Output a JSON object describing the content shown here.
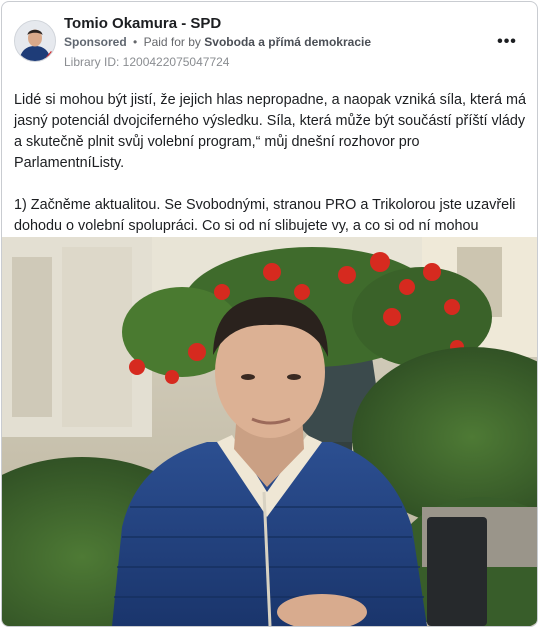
{
  "ad": {
    "page_name": "Tomio Okamura - SPD",
    "sponsored_label": "Sponsored",
    "separator": "•",
    "paid_for_prefix": "Paid for by",
    "funder": "Svoboda a přímá demokracie",
    "library_id": "Library ID: 1200422075047724",
    "more_icon": "more-horizontal-icon",
    "more_glyph": "•••"
  },
  "post": {
    "paragraph_1": "Lidé si mohou být jistí, že jejich hlas nepropadne, a naopak vzniká síla, která má jasný potenciál dvojciferného výsledku. Síla, která může být součástí příští vlády a skutečně plnit svůj volební program,“ můj dnešní rozhovor pro ParlamentníListy.",
    "paragraph_2": "1) Začněme aktualitou. Se Svobodnými, stranou PRO a Trikolorou jste uzavřeli dohodu o volební spolupráci. Co si od ní slibujete vy, a co si od ní mohou slibovat voliči?..."
  },
  "colors": {
    "border": "#c9ccd1",
    "text_primary": "#1c1e21",
    "text_secondary": "#65676b",
    "jacket": "#1f3f7a"
  }
}
